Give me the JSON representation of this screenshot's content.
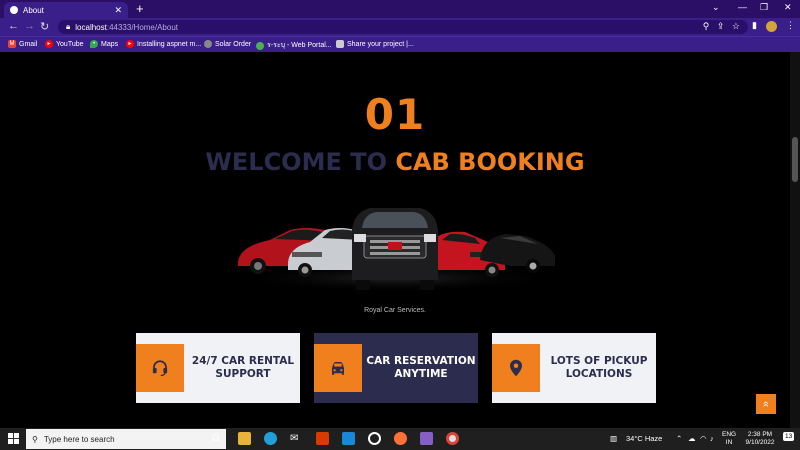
{
  "browser": {
    "tab_title": "About",
    "new_tab": "+",
    "url_host": "localhost",
    "url_rest": ":44333/Home/About",
    "window_controls": {
      "down": "⌄",
      "minimize": "—",
      "restore": "❐",
      "close": "✕"
    },
    "bookmarks": [
      {
        "label": "Gmail",
        "icon": "gmail-icon",
        "color": "#ea4335"
      },
      {
        "label": "YouTube",
        "icon": "youtube-icon",
        "color": "#ff0000"
      },
      {
        "label": "Maps",
        "icon": "maps-icon",
        "color": "#34a853"
      },
      {
        "label": "Installing aspnet m...",
        "icon": "youtube-icon",
        "color": "#ff0000"
      },
      {
        "label": "Solar Order",
        "icon": "globe-icon",
        "color": "#888888"
      },
      {
        "label": "ร-ระบุ - Web Portal...",
        "icon": "portal-icon",
        "color": "#4caf50"
      },
      {
        "label": "Share your project |...",
        "icon": "bookmark-icon",
        "color": "#cccccc"
      }
    ]
  },
  "page": {
    "number": "01",
    "heading_part1": "WELCOME TO ",
    "heading_part2": "CAB BOOKING",
    "tagline": "Royal Car Services.",
    "accent_color": "#f07f1d",
    "navy_color": "#2c2d4e",
    "features": [
      {
        "label": "24/7 CAR RENTAL SUPPORT",
        "icon": "headset-icon",
        "style": "light"
      },
      {
        "label": "CAR RESERVATION ANYTIME",
        "icon": "car-icon",
        "style": "dark"
      },
      {
        "label": "LOTS OF PICKUP LOCATIONS",
        "icon": "location-pin-icon",
        "style": "light"
      }
    ],
    "back_to_top": "»"
  },
  "taskbar": {
    "search_placeholder": "Type here to search",
    "weather": "34°C  Haze",
    "lang_top": "ENG",
    "lang_bottom": "IN",
    "time": "2:38 PM",
    "date": "9/10/2022",
    "notifications": "13"
  }
}
